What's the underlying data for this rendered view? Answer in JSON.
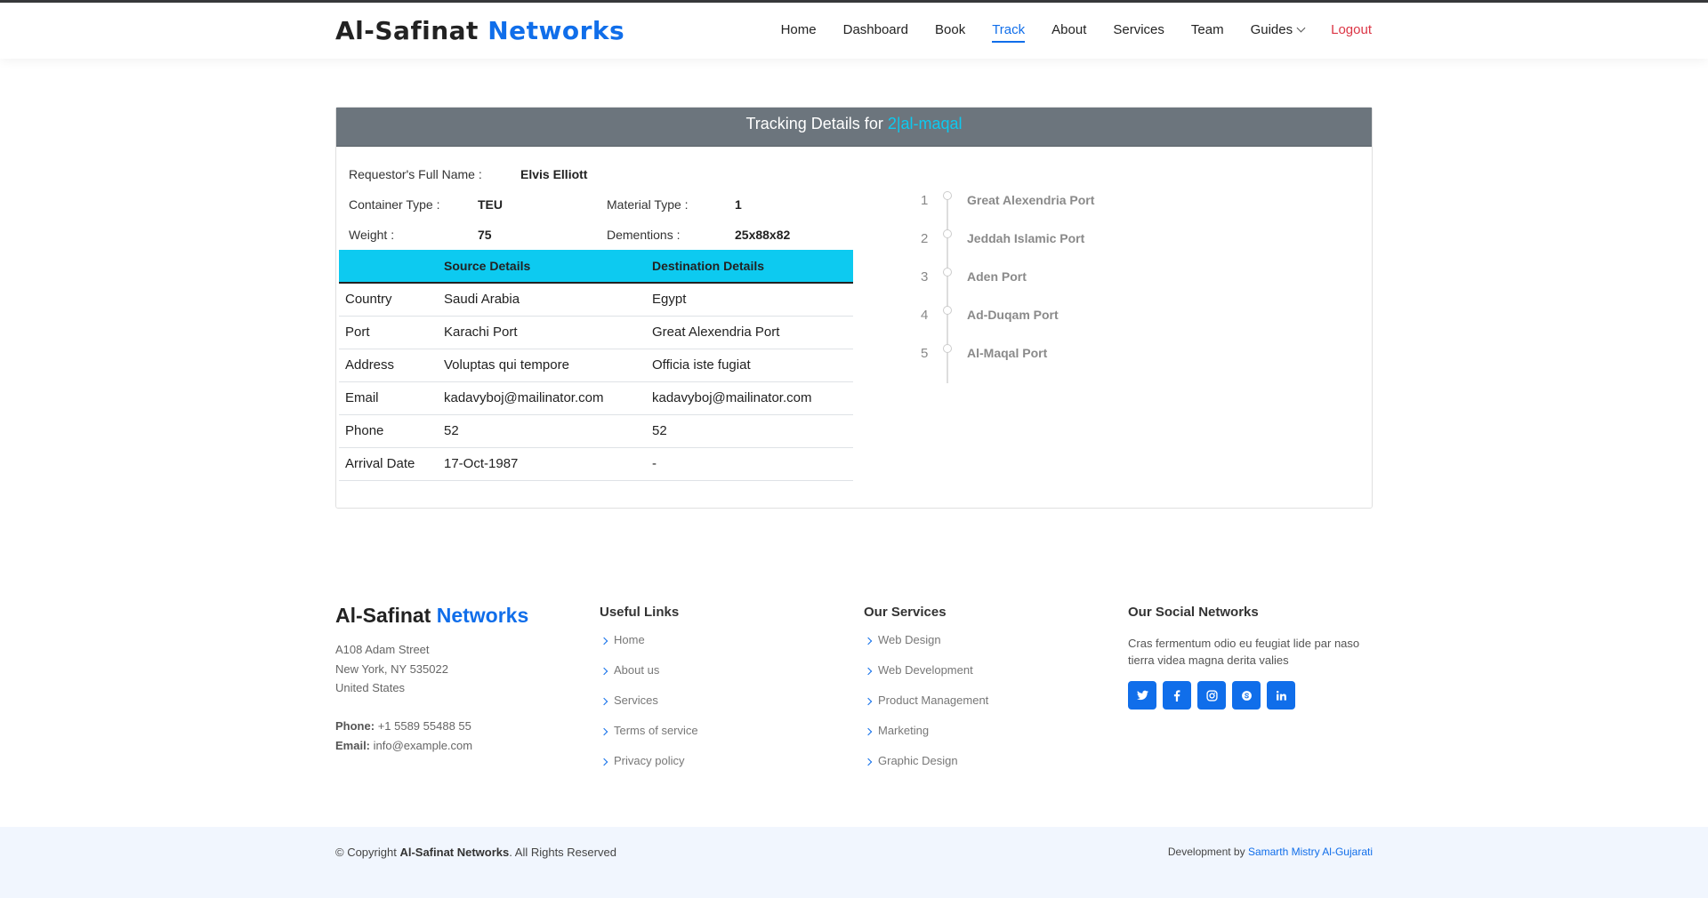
{
  "brand": {
    "name": "Al-Safinat",
    "accent": "Networks"
  },
  "nav": {
    "items": [
      {
        "label": "Home"
      },
      {
        "label": "Dashboard"
      },
      {
        "label": "Book"
      },
      {
        "label": "Track",
        "active": true
      },
      {
        "label": "About"
      },
      {
        "label": "Services"
      },
      {
        "label": "Team"
      },
      {
        "label": "Guides"
      },
      {
        "label": "Logout"
      }
    ]
  },
  "tracking": {
    "title": "Tracking Details for",
    "tracking_id": "2|al-maqal",
    "requestor_label": "Requestor's Full Name :",
    "requestor_value": "Elvis Elliott",
    "container_label": "Container Type :",
    "container_value": "TEU",
    "material_label": "Material Type :",
    "material_value": "1",
    "weight_label": "Weight :",
    "weight_value": "75",
    "dimensions_label": "Dementions :",
    "dimensions_value": "25x88x82",
    "table": {
      "headers": [
        "",
        "Source Details",
        "Destination Details"
      ],
      "rows": [
        [
          "Country",
          "Saudi Arabia",
          "Egypt"
        ],
        [
          "Port",
          "Karachi Port",
          "Great Alexendria Port"
        ],
        [
          "Address",
          "Voluptas qui tempore",
          "Officia iste fugiat"
        ],
        [
          "Email",
          "kadavyboj@mailinator.com",
          "kadavyboj@mailinator.com"
        ],
        [
          "Phone",
          "52",
          "52"
        ],
        [
          "Arrival Date",
          "17-Oct-1987",
          "-"
        ]
      ]
    },
    "route": [
      {
        "num": "1",
        "port": "Great Alexendria Port"
      },
      {
        "num": "2",
        "port": "Jeddah Islamic Port"
      },
      {
        "num": "3",
        "port": "Aden Port"
      },
      {
        "num": "4",
        "port": "Ad-Duqam Port"
      },
      {
        "num": "5",
        "port": "Al-Maqal Port"
      }
    ]
  },
  "footer": {
    "brand": {
      "name": "Al-Safinat",
      "accent": "Networks"
    },
    "address": [
      "A108 Adam Street",
      "New York, NY 535022",
      "United States"
    ],
    "phone_label": "Phone:",
    "phone": "+1 5589 55488 55",
    "email_label": "Email:",
    "email": "info@example.com",
    "useful_links_title": "Useful Links",
    "useful_links": [
      "Home",
      "About us",
      "Services",
      "Terms of service",
      "Privacy policy"
    ],
    "services_title": "Our Services",
    "services": [
      "Web Design",
      "Web Development",
      "Product Management",
      "Marketing",
      "Graphic Design"
    ],
    "social_title": "Our Social Networks",
    "social_text": "Cras fermentum odio eu feugiat lide par naso tierra videa magna derita valies",
    "social_icons": [
      "twitter-icon",
      "facebook-icon",
      "instagram-icon",
      "skype-icon",
      "linkedin-icon"
    ],
    "copyright_prefix": "© Copyright",
    "copyright_brand": "Al-Safinat Networks",
    "copyright_suffix": ". All Rights Reserved",
    "credit_prefix": "Development by",
    "credit_name": "Samarth Mistry Al-Gujarati"
  },
  "colors": {
    "accent": "#106eea",
    "info": "#0dcaf0",
    "header_gray": "#6c757d",
    "danger": "#dc3545"
  }
}
